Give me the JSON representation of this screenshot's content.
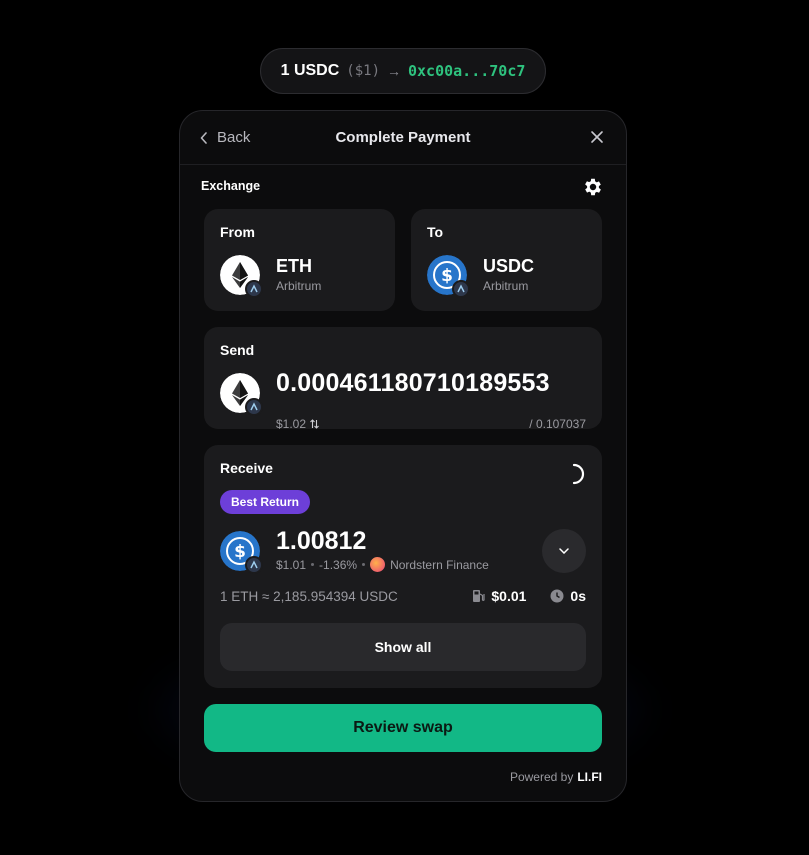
{
  "pill": {
    "amount": "1 USDC",
    "usd": "($1)",
    "address": "0xc00a...70c7"
  },
  "header": {
    "back": "Back",
    "title": "Complete Payment"
  },
  "exchange": {
    "label": "Exchange"
  },
  "from": {
    "label": "From",
    "token": "ETH",
    "chain": "Arbitrum"
  },
  "to": {
    "label": "To",
    "token": "USDC",
    "chain": "Arbitrum"
  },
  "send": {
    "label": "Send",
    "amount": "0.000461180710189553",
    "usd": "$1.02",
    "balance": "/ 0.107037"
  },
  "receive": {
    "label": "Receive",
    "badge": "Best Return",
    "amount": "1.00812",
    "usd": "$1.01",
    "impact": "-1.36%",
    "provider": "Nordstern Finance",
    "rate": "1 ETH ≈ 2,185.954394 USDC",
    "gas": "$0.01",
    "time": "0s",
    "show_all": "Show all"
  },
  "review_button": "Review swap",
  "powered": {
    "prefix": "Powered by",
    "brand": "LI.FI"
  },
  "colors": {
    "accent": "#12b886",
    "badge": "#6d3fd8",
    "address": "#2ec27e"
  }
}
